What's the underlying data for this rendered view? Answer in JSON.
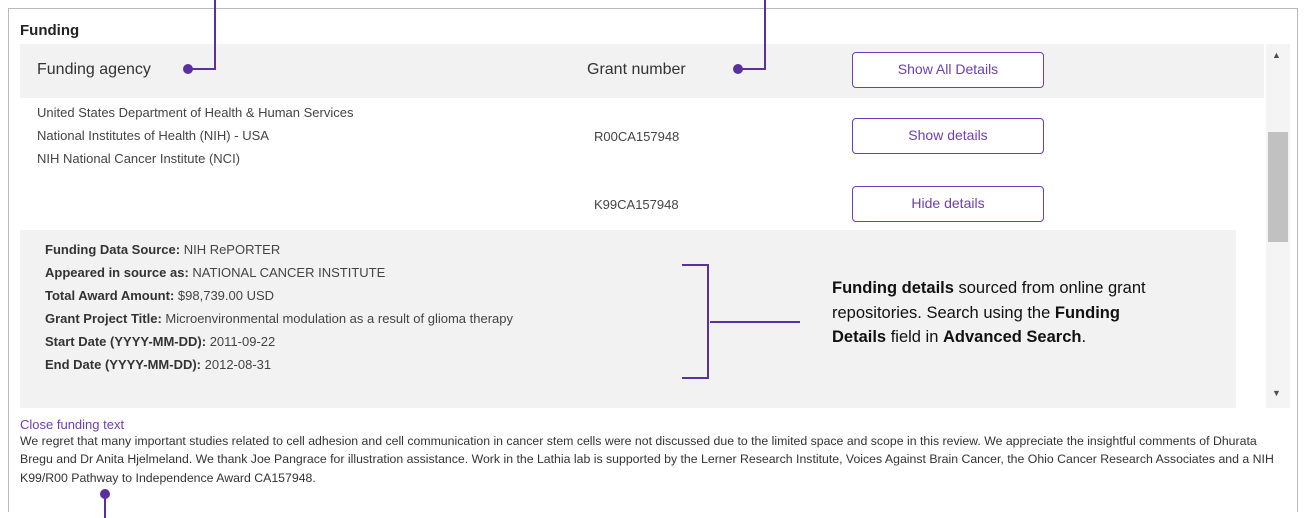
{
  "section_title": "Funding",
  "table": {
    "col_agency": "Funding agency",
    "col_grant": "Grant number",
    "show_all_label": "Show All Details",
    "agencies": [
      "United States Department of Health & Human Services",
      "National Institutes of Health (NIH) - USA",
      "NIH National Cancer Institute (NCI)"
    ],
    "grants": [
      {
        "number": "R00CA157948",
        "button": "Show details"
      },
      {
        "number": "K99CA157948",
        "button": "Hide details"
      }
    ]
  },
  "details": [
    {
      "label": "Funding Data Source:",
      "value": "NIH RePORTER"
    },
    {
      "label": "Appeared in source as:",
      "value": "NATIONAL CANCER INSTITUTE"
    },
    {
      "label": "Total Award Amount:",
      "value": "$98,739.00 USD"
    },
    {
      "label": "Grant Project Title:",
      "value": "Microenvironmental modulation as a result of glioma therapy"
    },
    {
      "label": "Start Date (YYYY-MM-DD):",
      "value": "2011-09-22"
    },
    {
      "label": "End Date (YYYY-MM-DD):",
      "value": "2012-08-31"
    }
  ],
  "close_link": "Close funding text",
  "funding_text": "We regret that many important studies related to cell adhesion and cell communication in cancer stem cells were not discussed due to the limited space and scope in this review. We appreciate the insightful comments of Dhurata Bregu and Dr Anita Hjelmeland. We thank Joe Pangrace for illustration assistance. Work in the Lathia lab is supported by the Lerner Research Institute, Voices Against Brain Cancer, the Ohio Cancer Research Associates and a NIH K99/R00 Pathway to Independence Award CA157948.",
  "callout": {
    "bold1": "Funding details",
    "text1": " sourced from online grant repositories.  Search using the ",
    "bold2": "Funding Details",
    "text2": " field in ",
    "bold3": "Advanced Search",
    "text3": "."
  },
  "colors": {
    "accent": "#6e3db3",
    "annotation": "#5a2fa0",
    "header_bg": "#f2f2f2"
  },
  "icons": {
    "scroll_up": "triangle-up",
    "scroll_down": "triangle-down"
  }
}
